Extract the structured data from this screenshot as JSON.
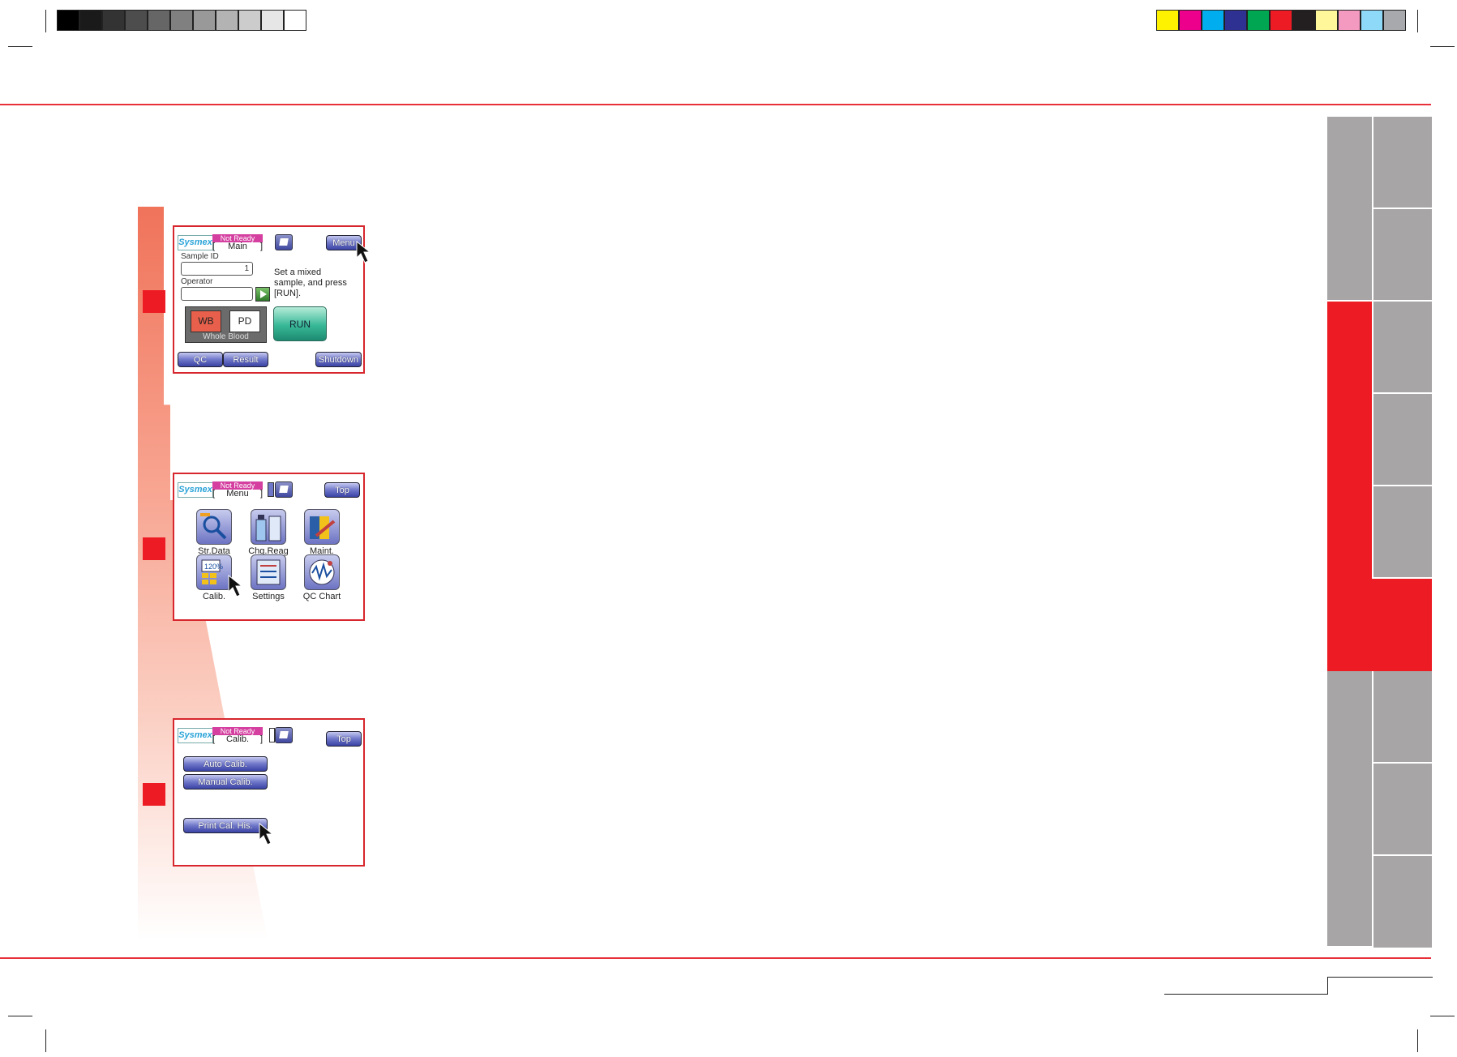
{
  "print_marks": {
    "gray_swatches": [
      "#000000",
      "#1a1a1a",
      "#333333",
      "#4d4d4d",
      "#666666",
      "#808080",
      "#999999",
      "#b3b3b3",
      "#cccccc",
      "#e6e6e6",
      "#ffffff"
    ],
    "color_swatches": [
      "#fff200",
      "#ec008c",
      "#00aeef",
      "#2e3192",
      "#00a651",
      "#ed1c24",
      "#231f20",
      "#fff799",
      "#f49ac1",
      "#8ed8f8",
      "#a7a9ac"
    ]
  },
  "colors": {
    "accent": "#ed1c24",
    "tab_gray": "#a7a5a6",
    "rule_red": "#e8303a"
  },
  "screens": {
    "main": {
      "logo": "Sysmex",
      "status": "Not Ready",
      "name": "Main",
      "menu_button": "Menu",
      "sample_id_label": "Sample ID",
      "sample_id_value": "1",
      "operator_label": "Operator",
      "operator_value": "",
      "instruction": "Set a mixed sample, and press [RUN].",
      "mode_wb": "WB",
      "mode_pd": "PD",
      "mode_caption": "Whole Blood",
      "run_button": "RUN",
      "qc_button": "QC",
      "result_button": "Result",
      "shutdown_button": "Shutdown"
    },
    "menu": {
      "logo": "Sysmex",
      "status": "Not Ready",
      "name": "Menu",
      "top_button": "Top",
      "items": [
        {
          "label": "Str.Data",
          "icon": "stored-data-icon"
        },
        {
          "label": "Chg.Reag",
          "icon": "change-reagent-icon"
        },
        {
          "label": "Maint.",
          "icon": "maintenance-icon"
        },
        {
          "label": "Calib.",
          "icon": "calibration-icon"
        },
        {
          "label": "Settings",
          "icon": "settings-icon"
        },
        {
          "label": "QC Chart",
          "icon": "qc-chart-icon"
        }
      ]
    },
    "calib": {
      "logo": "Sysmex",
      "status": "Not Ready",
      "name": "Calib.",
      "top_button": "Top",
      "auto_calib_button": "Auto Calib.",
      "manual_calib_button": "Manual Calib.",
      "print_cal_his_button": "Print Cal. His."
    }
  }
}
